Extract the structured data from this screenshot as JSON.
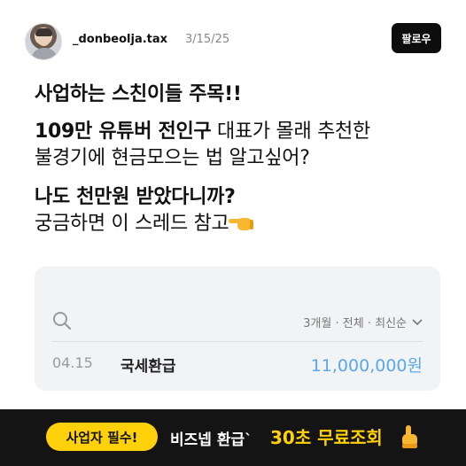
{
  "post": {
    "username": "_donbeolja.tax",
    "date": "3/15/25",
    "follow_label": "팔로우",
    "lines": [
      {
        "bold": "사업하는 스친이들 주목!!",
        "regular": ""
      },
      {
        "bold": "109만 유튜버 전인구",
        "regular": " 대표가 몰래 추천한"
      },
      {
        "bold": "",
        "regular": "불경기에 현금모으는 법 알고싶어?"
      },
      {
        "bold": "나도 천만원 받았다니까?",
        "regular": ""
      },
      {
        "bold": "",
        "regular": "궁금하면 이 스레드 참고"
      }
    ]
  },
  "card": {
    "filter_label": "3개월 · 전체 · 최신순",
    "row": {
      "date": "04.15",
      "title": "국세환급",
      "amount": "11,000,000원"
    }
  },
  "banner": {
    "pill_label": "사업자 필수!",
    "text": "비즈넵 환급`",
    "highlight": "30초 무료조회"
  },
  "colors": {
    "accent_yellow": "#ffd10a",
    "amount_blue": "#5aa8e8",
    "banner_bg": "#141414"
  },
  "icons": [
    "avatar",
    "search-icon",
    "chevron-down-icon",
    "pointing-right-emoji",
    "pointing-up-hand-icon"
  ]
}
